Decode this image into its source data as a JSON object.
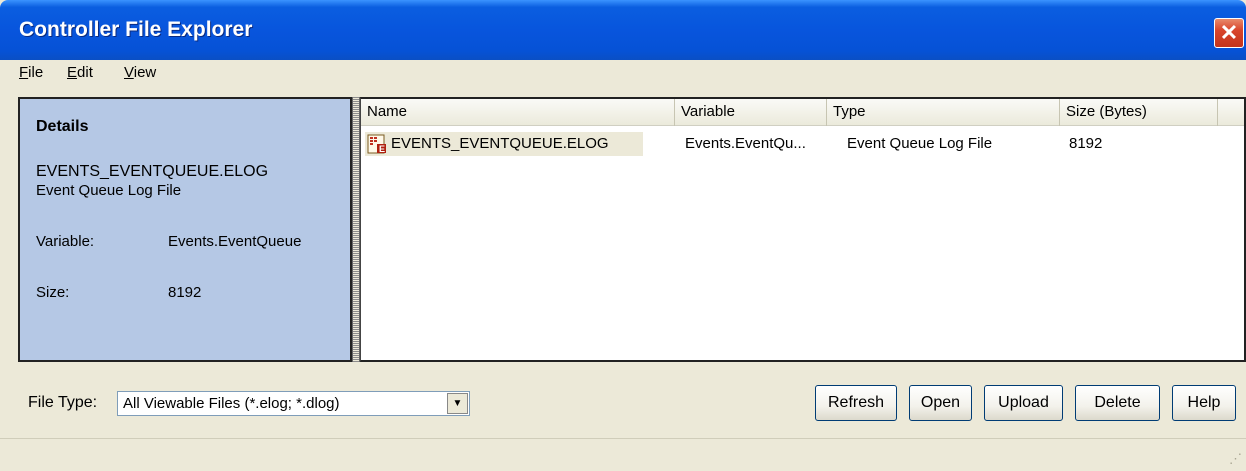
{
  "window": {
    "title": "Controller File Explorer",
    "close_symbol": "✕"
  },
  "menu": [
    {
      "mnemonic": "F",
      "rest": "ile"
    },
    {
      "mnemonic": "E",
      "rest": "dit"
    },
    {
      "mnemonic": "V",
      "rest": "iew"
    }
  ],
  "details": {
    "heading": "Details",
    "file_name": "EVENTS_EVENTQUEUE.ELOG",
    "file_type": "Event Queue Log File",
    "variable_label": "Variable:",
    "variable_value": "Events.EventQueue",
    "size_label": "Size:",
    "size_value": "8192",
    "background": "#B5C8E5"
  },
  "list": {
    "columns": [
      "Name",
      "Variable",
      "Type",
      "Size (Bytes)"
    ],
    "rows": [
      {
        "icon": "elog-file-icon",
        "name": "EVENTS_EVENTQUEUE.ELOG",
        "variable": "Events.EventQu...",
        "type": "Event Queue Log File",
        "size": "8192",
        "selected": true
      }
    ]
  },
  "footer": {
    "file_type_label": "File Type:",
    "file_type_value": "All Viewable Files (*.elog; *.dlog)",
    "buttons": {
      "refresh": "Refresh",
      "open": "Open",
      "upload": "Upload",
      "delete": "Delete",
      "help": "Help"
    }
  },
  "colors": {
    "title_bar": "#0855DD",
    "window_bg": "#ECE9D8",
    "close_button": "#D9452C"
  }
}
